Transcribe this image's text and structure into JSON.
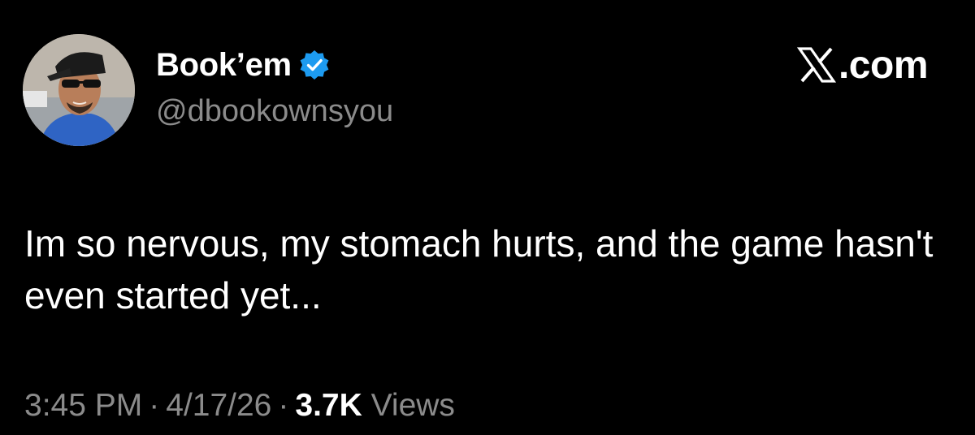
{
  "author": {
    "display_name": "Book’em",
    "handle": "@dbookownsyou",
    "verified": true,
    "verified_color": "#1d9bf0",
    "avatar_icon": "profile-photo"
  },
  "brand": {
    "logo_icon": "x-logo-icon",
    "text": ".com"
  },
  "tweet": {
    "text": "Im so nervous, my stomach hurts, and the game hasn't even started yet..."
  },
  "meta": {
    "time": "3:45 PM",
    "separator": "·",
    "date": "4/17/26",
    "views_count": "3.7K",
    "views_label": "Views"
  },
  "colors": {
    "background": "#000000",
    "primary_text": "#ffffff",
    "secondary_text": "#8b8b8b"
  }
}
